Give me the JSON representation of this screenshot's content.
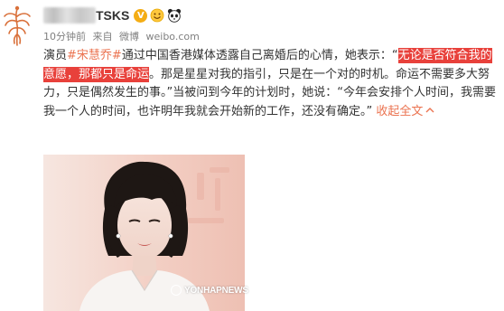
{
  "user": {
    "name_visible_suffix": "TSKS",
    "verified_badge": "V",
    "badge_color": "#f4ad14"
  },
  "meta": {
    "time": "10分钟前",
    "source_prefix": "来自",
    "source": "微博",
    "domain": "weibo.com"
  },
  "post": {
    "prefix": "演员",
    "topic": "#宋慧乔#",
    "text_1": "通过中国香港媒体透露自己离婚后的心情，她表示：“",
    "highlight": "无论是否符合我的意愿，那都只是命运",
    "text_2": "。那是星星对我的指引，只是在一个对的时机。命运不需要多大努力，只是偶然发生的事。”当被问到今年的计划时，她说：“今年会安排个人时间，我需要我一个人的时间，也许明年我就会开始新的工作，还没有确定。”",
    "collapse_label": "收起全文",
    "collapse_icon": "chevron-up-icon",
    "topic_color": "#eb7350",
    "highlight_color": "#e8413b"
  },
  "photo": {
    "watermark": "YONHAPNEWS"
  }
}
